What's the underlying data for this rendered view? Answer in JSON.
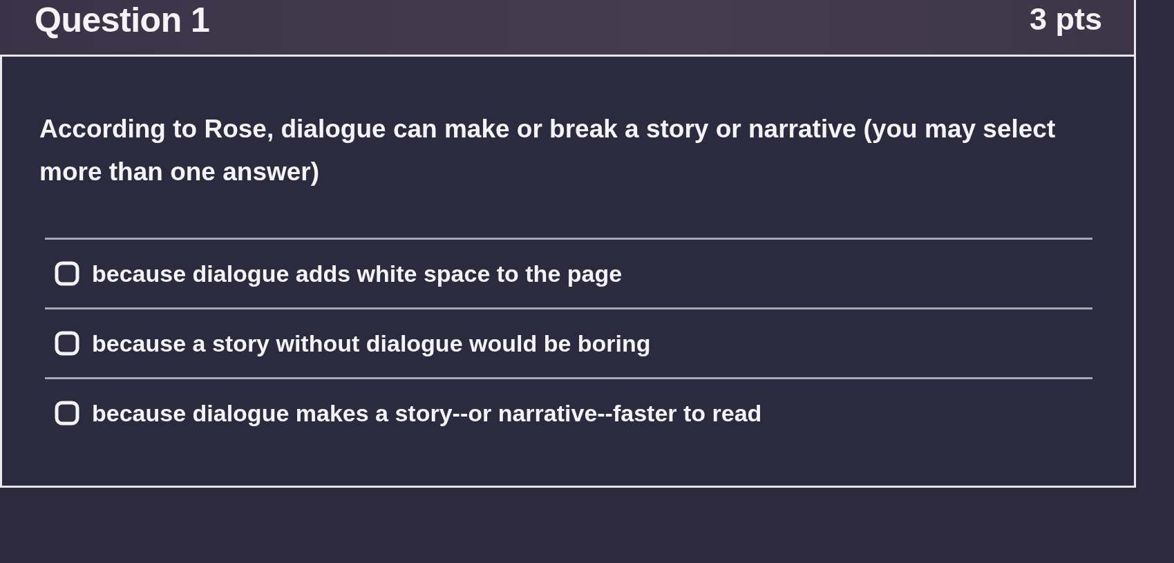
{
  "question": {
    "title": "Question 1",
    "points": "3 pts",
    "text": "According to Rose, dialogue can make or break a story or narrative (you may select more than one answer)",
    "answers": [
      {
        "label": "because dialogue adds white space to the page",
        "checked": false
      },
      {
        "label": "because a story without dialogue would be boring",
        "checked": false
      },
      {
        "label": "because dialogue makes a story--or narrative--faster to read",
        "checked": false
      }
    ]
  }
}
